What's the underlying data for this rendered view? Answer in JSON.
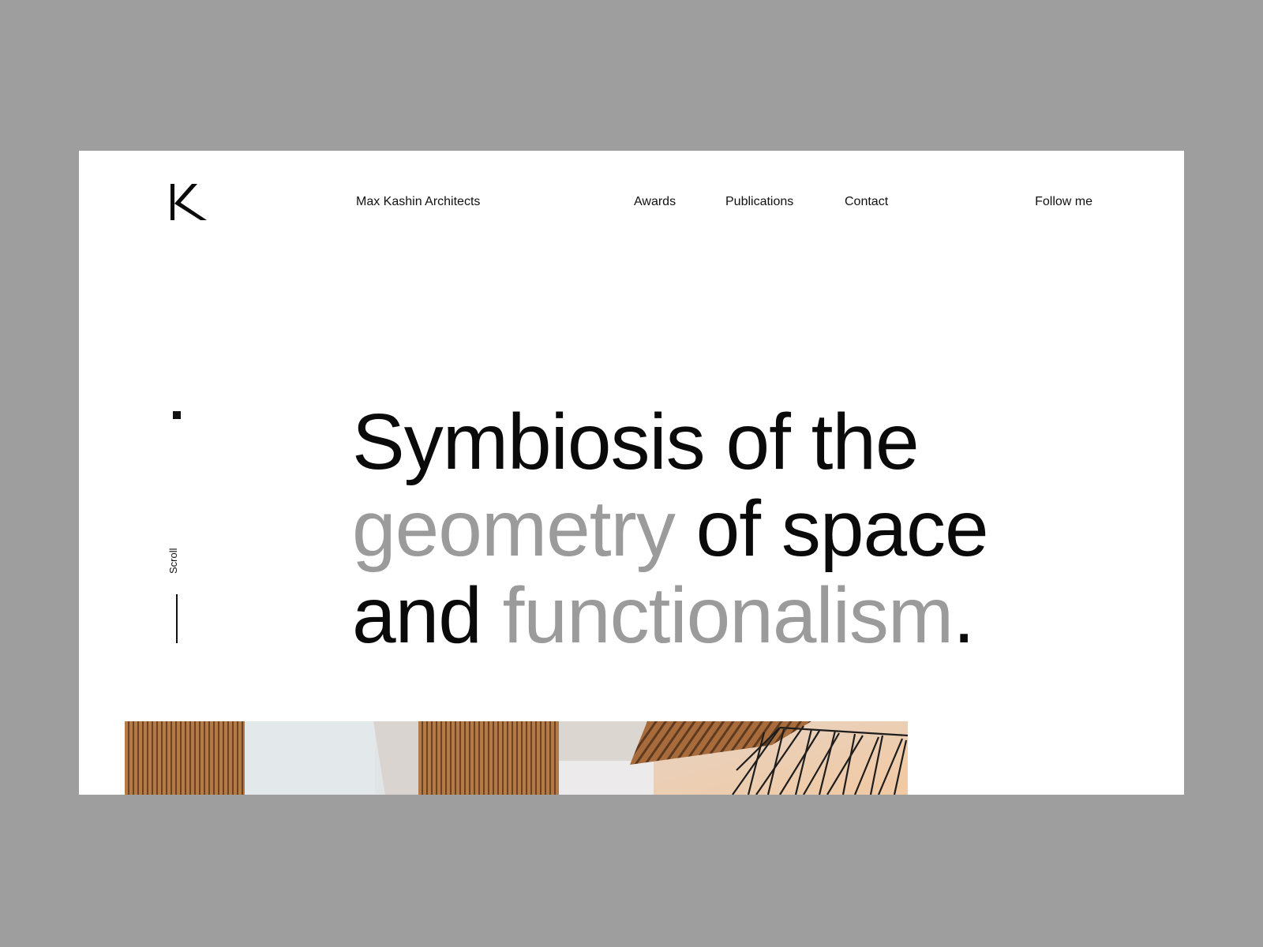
{
  "header": {
    "logo_letter": "K",
    "brand": "Max Kashin Architects",
    "nav": [
      "Awards",
      "Publications",
      "Contact"
    ],
    "follow": "Follow me"
  },
  "hero": {
    "line1": "Symbiosis of the",
    "line2_grey": "geometry",
    "line2_dark": " of space",
    "line3_dark": "and ",
    "line3_grey": "functionalism",
    "line3_end": ".",
    "scroll_label": "Scroll"
  },
  "colors": {
    "backdrop": "#9e9e9e",
    "page": "#ffffff",
    "text": "#0a0a0a",
    "accent_grey": "#9b9b9b",
    "wood": "#a8703f"
  }
}
